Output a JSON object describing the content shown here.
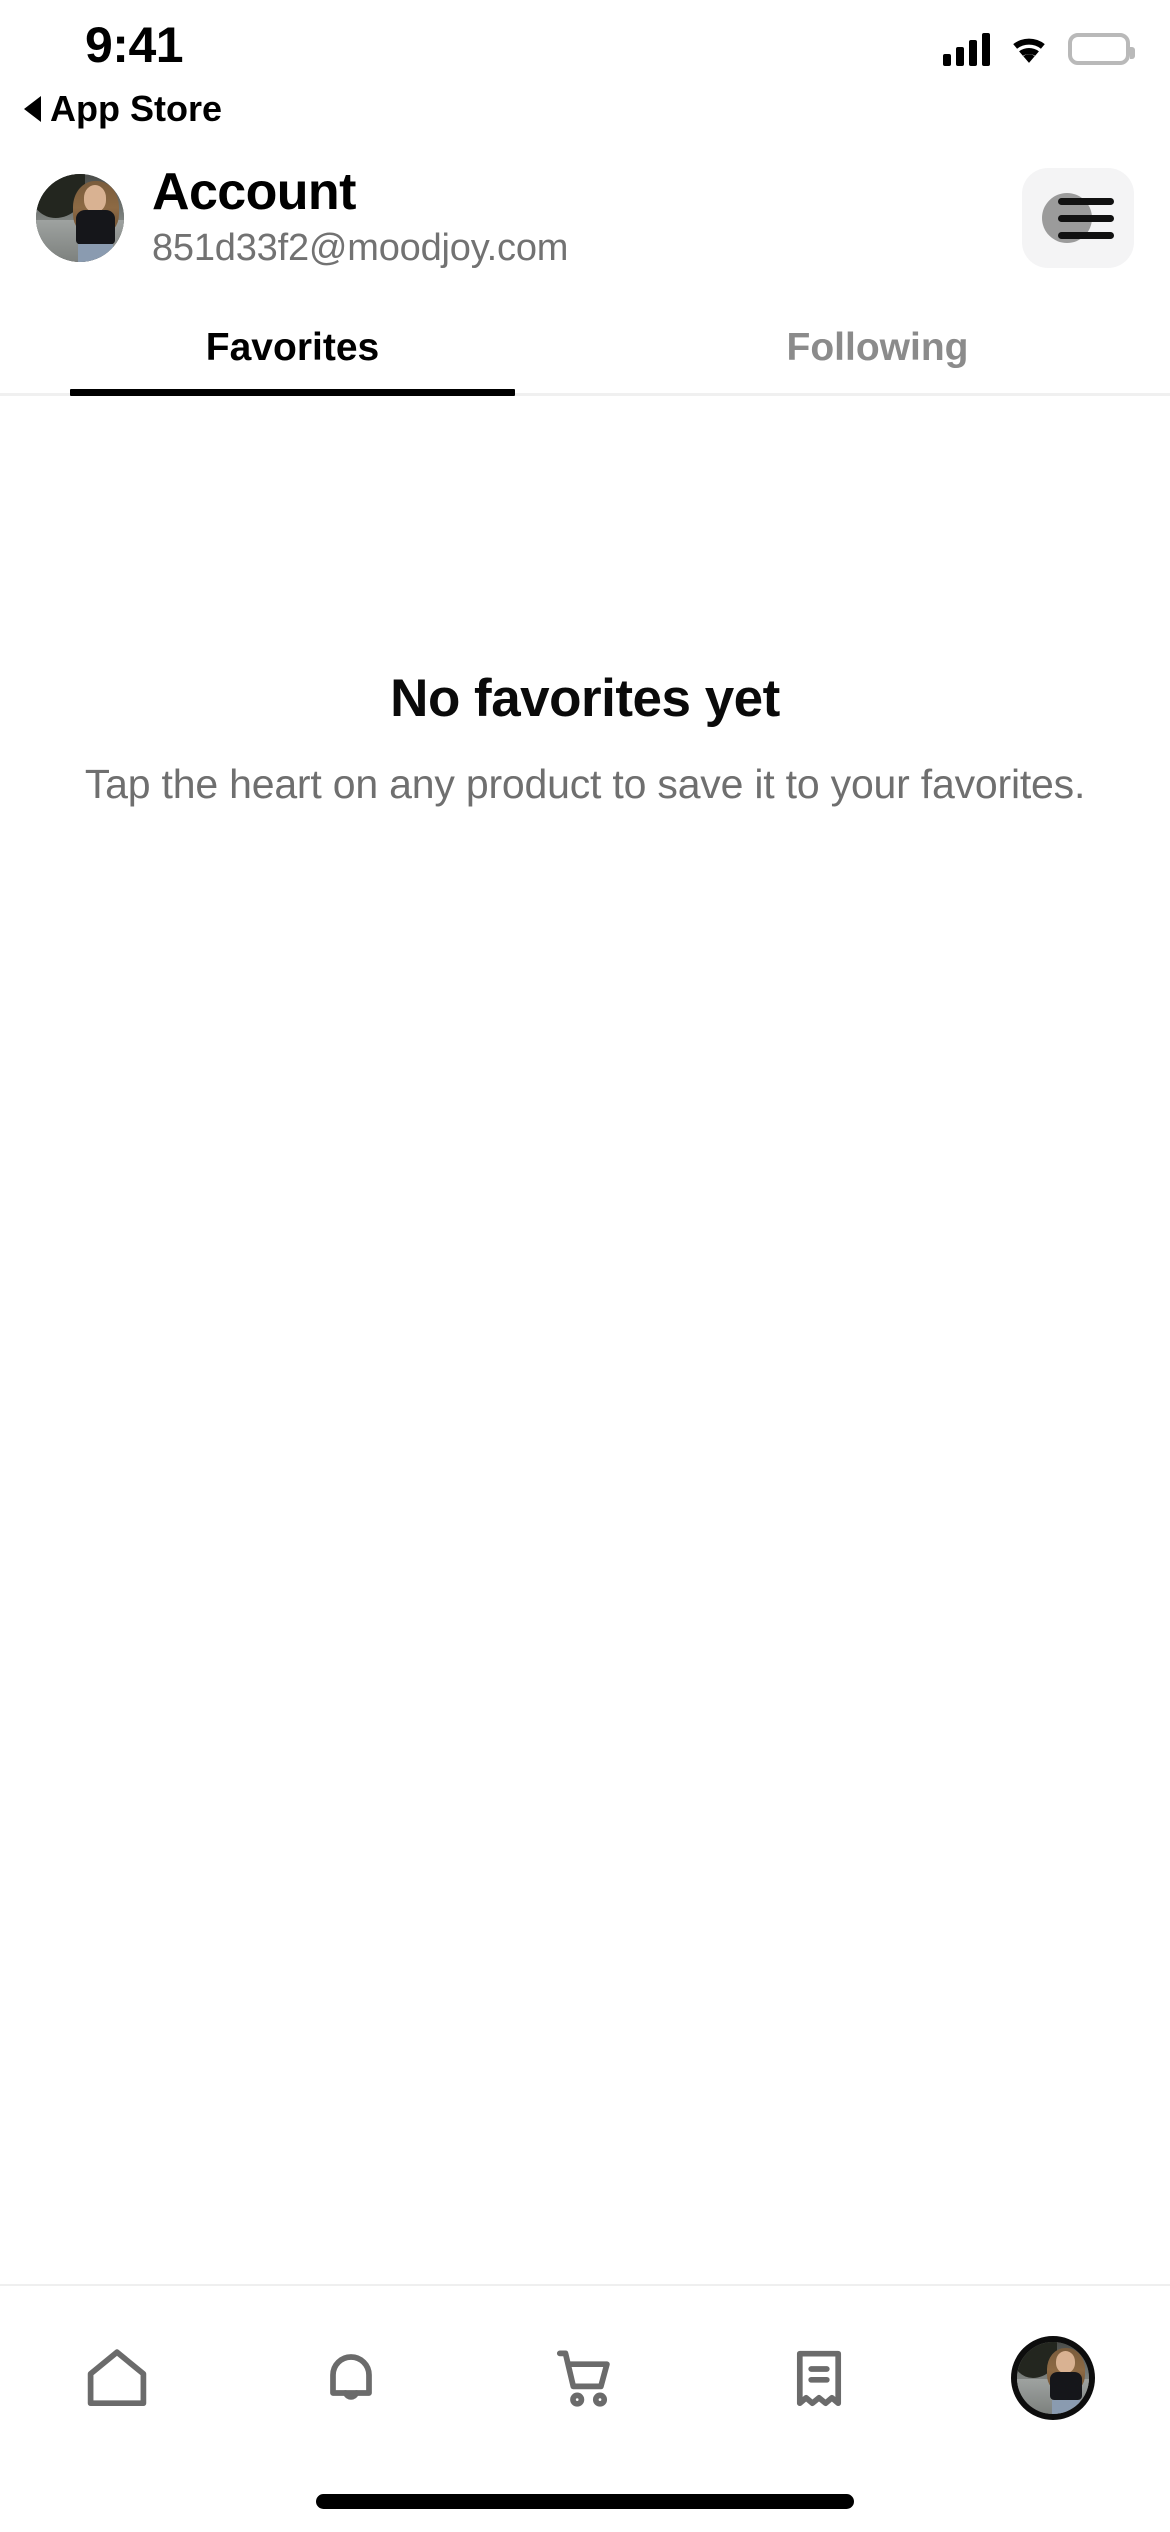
{
  "status_bar": {
    "time": "9:41",
    "back_label": "App Store",
    "signal_icon": "cellular-signal-icon",
    "wifi_icon": "wifi-icon",
    "battery_icon": "battery-full-icon"
  },
  "header": {
    "title": "Account",
    "email": "851d33f2@moodjoy.com",
    "avatar_name": "user-avatar",
    "menu_icon": "hamburger-menu-icon"
  },
  "tabs": {
    "items": [
      {
        "label": "Favorites",
        "active": true
      },
      {
        "label": "Following",
        "active": false
      }
    ]
  },
  "empty_state": {
    "title": "No favorites yet",
    "subtitle": "Tap the heart on any product to save it to your favorites."
  },
  "tab_bar": {
    "items": [
      {
        "name": "home-icon",
        "active": false
      },
      {
        "name": "bell-icon",
        "active": false
      },
      {
        "name": "shopping-cart-icon",
        "active": false
      },
      {
        "name": "receipt-icon",
        "active": false
      },
      {
        "name": "profile-avatar",
        "active": true
      }
    ]
  },
  "colors": {
    "accent": "#000000",
    "muted_text": "#727272",
    "inactive_tab": "#8b8b8b",
    "icon_gray": "#6b6b6b",
    "menu_button_bg": "#f4f4f5",
    "divider": "#efefef"
  }
}
